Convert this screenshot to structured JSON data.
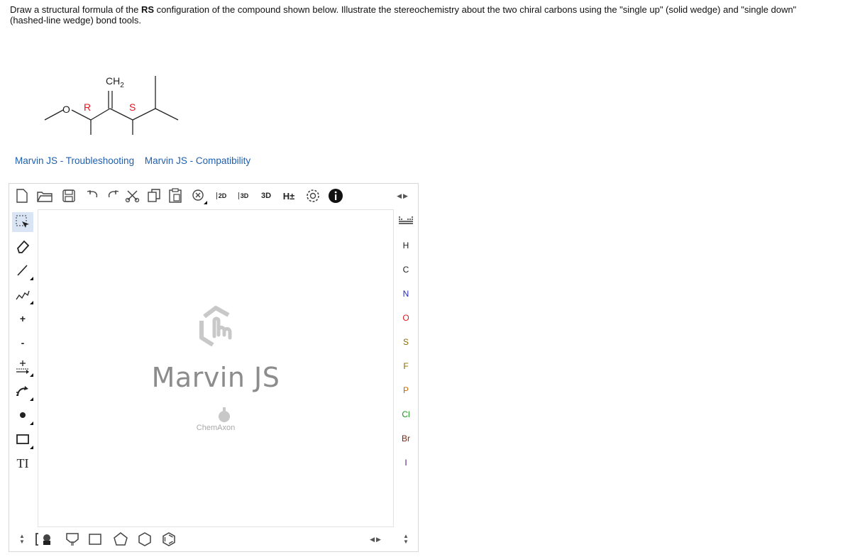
{
  "question": {
    "part1": "Draw a structural formula of the ",
    "bold": "RS",
    "part2": " configuration of the compound shown below. Illustrate the stereochemistry about the two chiral carbons using the \"single up\" (solid wedge) and \"single down\" (hashed-line wedge) bond tools."
  },
  "molecule": {
    "ch2_label": "CH",
    "ch2_sub": "2",
    "oxygen_label": "O",
    "r_label": "R",
    "s_label": "S",
    "stereo_color": "#e8141b"
  },
  "links": {
    "troubleshooting": "Marvin JS - Troubleshooting",
    "compatibility": "Marvin JS - Compatibility"
  },
  "editor": {
    "top_tools": {
      "clean2d": "2D",
      "clean3d": "3D",
      "view3d": "3D",
      "hydrogen": "H±"
    },
    "watermark": "Marvin JS",
    "watermark_sub": "ChemAxon",
    "left_tools": {
      "plus": "+",
      "minus": "-",
      "text": "TI"
    },
    "elements": [
      {
        "symbol": "H",
        "color": "#222222"
      },
      {
        "symbol": "C",
        "color": "#222222"
      },
      {
        "symbol": "N",
        "color": "#2a2ab8"
      },
      {
        "symbol": "O",
        "color": "#e01b1b"
      },
      {
        "symbol": "S",
        "color": "#8a6d00"
      },
      {
        "symbol": "F",
        "color": "#8a6d00"
      },
      {
        "symbol": "P",
        "color": "#c06a00"
      },
      {
        "symbol": "Cl",
        "color": "#1a9a1a"
      },
      {
        "symbol": "Br",
        "color": "#7a2a10"
      },
      {
        "symbol": "I",
        "color": "#5a1a7a"
      }
    ],
    "accent": "#d9e4f5"
  }
}
